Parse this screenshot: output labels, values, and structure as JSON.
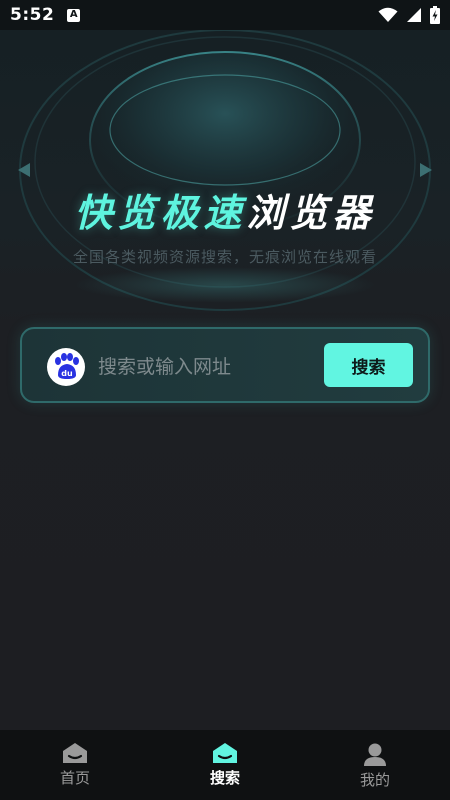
{
  "status_bar": {
    "time": "5:52",
    "notification_icon": "a-badge-icon",
    "icons": [
      "wifi-icon",
      "signal-icon",
      "battery-charging-icon"
    ]
  },
  "hero": {
    "title_accent": "快览极速",
    "title_plain": "浏览器",
    "subtitle": "全国各类视频资源搜索，无痕浏览在线观看"
  },
  "search": {
    "engine_icon": "baidu-logo-icon",
    "engine_text": "du",
    "placeholder": "搜索或输入网址",
    "value": "",
    "button_label": "搜索"
  },
  "bottom_nav": {
    "items": [
      {
        "label": "首页",
        "icon": "home-icon",
        "active": false
      },
      {
        "label": "搜索",
        "icon": "home-icon",
        "active": true
      },
      {
        "label": "我的",
        "icon": "user-icon",
        "active": false
      }
    ]
  },
  "colors": {
    "accent": "#61f5e1",
    "background": "#1d1e22",
    "nav_background": "#0f1112",
    "inactive_icon": "#9a9a9a"
  }
}
